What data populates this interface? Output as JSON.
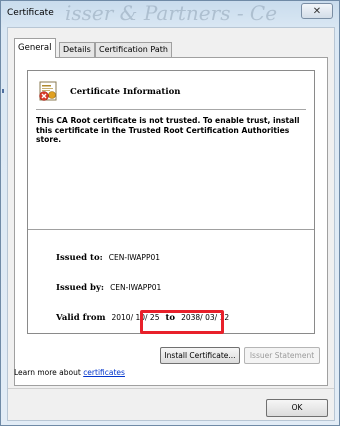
{
  "window": {
    "title": "Certificate",
    "watermark": "isser & Partners - Ce",
    "close_glyph": "✕"
  },
  "tabs": [
    {
      "label": "General"
    },
    {
      "label": "Details"
    },
    {
      "label": "Certification Path"
    }
  ],
  "info": {
    "title": "Certificate Information",
    "warning": "This CA Root certificate is not trusted. To enable trust, install this certificate in the Trusted Root Certification Authorities store.",
    "issued_to_label": "Issued to:",
    "issued_to_value": "CEN-IWAPP01",
    "issued_by_label": "Issued by:",
    "issued_by_value": "CEN-IWAPP01",
    "valid_from_label": "Valid from",
    "valid_from_value": "2010/ 10/ 25",
    "to_label": "to",
    "valid_to_value": "2038/ 03/ 12"
  },
  "buttons": {
    "install": "Install Certificate...",
    "issuer": "Issuer Statement",
    "ok": "OK"
  },
  "learn": {
    "prefix": "Learn more about ",
    "link": "certificates"
  },
  "colors": {
    "highlight": "#e8202a",
    "link": "#0033cc"
  },
  "icons": [
    "certificate-icon",
    "close-icon"
  ]
}
